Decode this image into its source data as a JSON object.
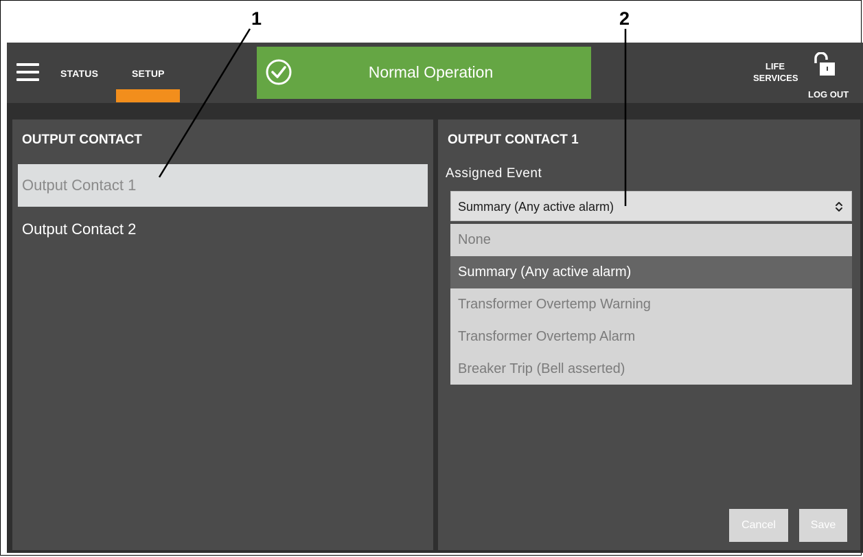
{
  "callouts": [
    "1",
    "2"
  ],
  "nav": {
    "tabs": [
      {
        "label": "STATUS",
        "active": false
      },
      {
        "label": "SETUP",
        "active": true
      }
    ],
    "status_banner": "Normal Operation",
    "life_services": [
      "LIFE",
      "SERVICES"
    ],
    "logout": "LOG OUT"
  },
  "left_panel": {
    "title": "OUTPUT CONTACT",
    "items": [
      {
        "label": "Output Contact 1",
        "selected": true
      },
      {
        "label": "Output Contact 2",
        "selected": false
      }
    ]
  },
  "right_panel": {
    "title": "OUTPUT CONTACT 1",
    "field_label": "Assigned Event",
    "select_value": "Summary (Any active alarm)",
    "options": [
      "None",
      "Summary (Any active alarm)",
      "Transformer Overtemp Warning",
      "Transformer Overtemp Alarm",
      "Breaker Trip (Bell asserted)"
    ],
    "highlighted_option": "Summary (Any active alarm)",
    "cancel_label": "Cancel",
    "save_label": "Save"
  },
  "colors": {
    "topbar": "#414141",
    "accent": "#f28e1c",
    "status_ok": "#65a644",
    "panel": "#4b4b4b"
  },
  "icons": [
    "menu-icon",
    "check-circle-icon",
    "unlock-icon",
    "select-arrows-icon"
  ]
}
